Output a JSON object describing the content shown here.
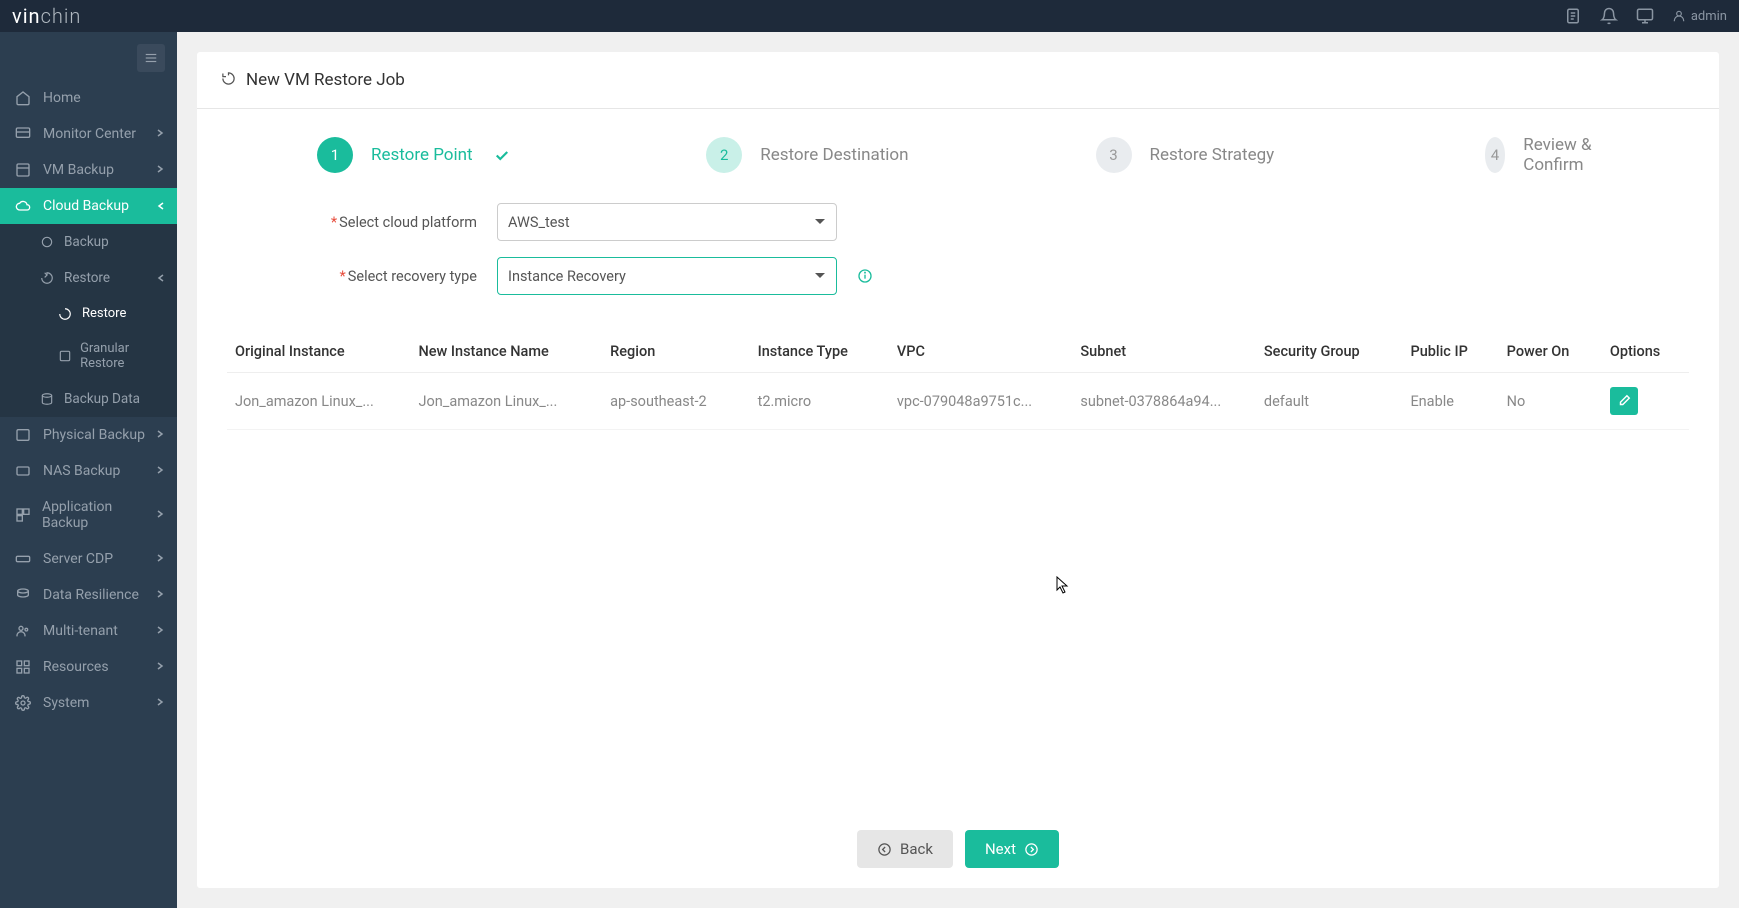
{
  "brand": {
    "part1": "vin",
    "part2": "chin"
  },
  "user": "admin",
  "nav": {
    "home": "Home",
    "monitor": "Monitor Center",
    "vmbackup": "VM Backup",
    "cloudbackup": "Cloud Backup",
    "cb_backup": "Backup",
    "cb_restore": "Restore",
    "cb_restore_sub": "Restore",
    "cb_granular": "Granular Restore",
    "cb_backupdata": "Backup Data",
    "physical": "Physical Backup",
    "nas": "NAS Backup",
    "app": "Application Backup",
    "cdp": "Server CDP",
    "resilience": "Data Resilience",
    "multitenant": "Multi-tenant",
    "resources": "Resources",
    "system": "System"
  },
  "page": {
    "title": "New VM Restore Job",
    "steps": {
      "s1": "Restore Point",
      "s2": "Restore Destination",
      "s3": "Restore Strategy",
      "s4": "Review & Confirm"
    },
    "form": {
      "platform_label": "Select cloud platform",
      "platform_value": "AWS_test",
      "recovery_label": "Select recovery type",
      "recovery_value": "Instance Recovery"
    },
    "table": {
      "headers": {
        "original": "Original Instance",
        "newname": "New Instance Name",
        "region": "Region",
        "itype": "Instance Type",
        "vpc": "VPC",
        "subnet": "Subnet",
        "sg": "Security Group",
        "pip": "Public IP",
        "power": "Power On",
        "options": "Options"
      },
      "rows": [
        {
          "original": "Jon_amazon Linux_...",
          "newname": "Jon_amazon Linux_...",
          "region": "ap-southeast-2",
          "itype": "t2.micro",
          "vpc": "vpc-079048a9751c...",
          "subnet": "subnet-0378864a94...",
          "sg": "default",
          "pip": "Enable",
          "power": "No"
        }
      ]
    },
    "buttons": {
      "back": "Back",
      "next": "Next"
    }
  }
}
